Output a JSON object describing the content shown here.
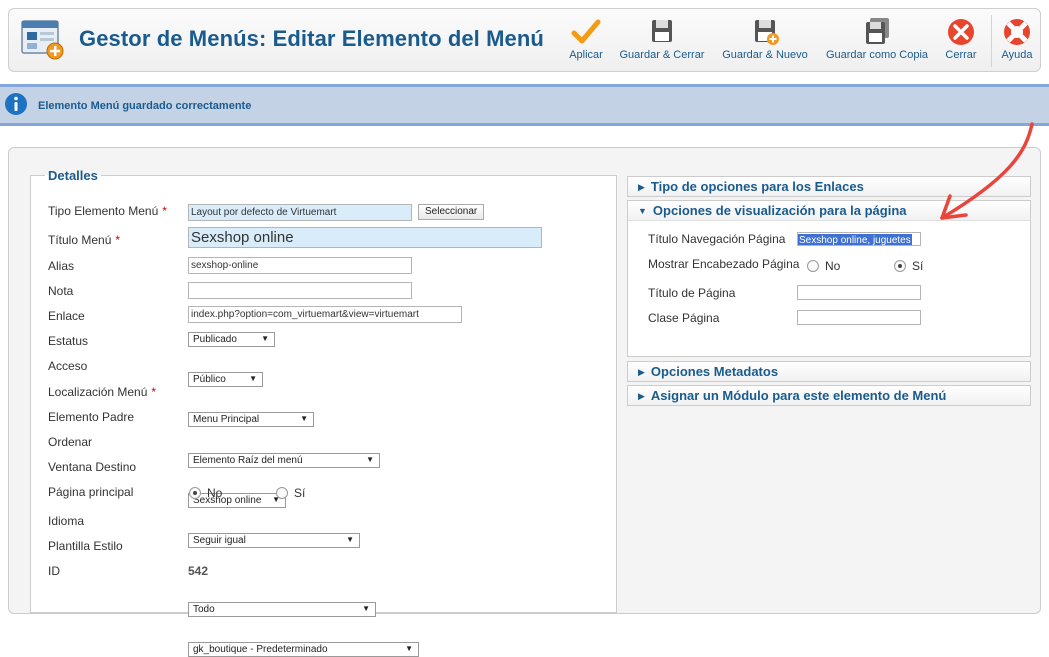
{
  "header": {
    "title": "Gestor de Menús: Editar Elemento del Menú"
  },
  "toolbar": [
    {
      "id": "apply",
      "label": "Aplicar",
      "icon": "checkmark-icon"
    },
    {
      "id": "save-close",
      "label": "Guardar & Cerrar",
      "icon": "floppy-icon"
    },
    {
      "id": "save-new",
      "label": "Guardar & Nuevo",
      "icon": "floppy-plus-icon"
    },
    {
      "id": "save-copy",
      "label": "Guardar como Copia",
      "icon": "floppy-copy-icon"
    },
    {
      "id": "close",
      "label": "Cerrar",
      "icon": "cancel-icon"
    },
    {
      "id": "help",
      "label": "Ayuda",
      "icon": "lifebuoy-icon"
    }
  ],
  "message": {
    "text": "Elemento Menú guardado correctamente",
    "icon": "info-icon"
  },
  "details": {
    "legend": "Detalles",
    "menu_type": {
      "label": "Tipo Elemento Menú",
      "value": "Layout por defecto de Virtuemart",
      "button": "Seleccionar"
    },
    "menu_title": {
      "label": "Título Menú",
      "value": "Sexshop online"
    },
    "alias": {
      "label": "Alias",
      "value": "sexshop-online"
    },
    "note": {
      "label": "Nota",
      "value": ""
    },
    "link": {
      "label": "Enlace",
      "value": "index.php?option=com_virtuemart&view=virtuemart"
    },
    "status": {
      "label": "Estatus",
      "value": "Publicado"
    },
    "access": {
      "label": "Acceso",
      "value": "Público"
    },
    "menu_location": {
      "label": "Localización Menú",
      "value": "Menu Principal"
    },
    "parent": {
      "label": "Elemento Padre",
      "value": "Elemento Raíz del menú"
    },
    "ordering": {
      "label": "Ordenar",
      "value": "Sexshop online"
    },
    "target": {
      "label": "Ventana Destino",
      "value": "Seguir igual"
    },
    "home": {
      "label": "Página principal",
      "options": [
        "No",
        "Sí"
      ],
      "selected": "No"
    },
    "language": {
      "label": "Idioma",
      "value": "Todo"
    },
    "template_style": {
      "label": "Plantilla Estilo",
      "value": "gk_boutique - Predeterminado"
    },
    "id": {
      "label": "ID",
      "value": "542"
    },
    "required_mark": "*"
  },
  "accordion": {
    "link_type": {
      "title": "Tipo de opciones para los Enlaces"
    },
    "page_display": {
      "title": "Opciones de visualización para la página",
      "browser_title": {
        "label": "Título Navegación Página",
        "value": "Sexshop online, juguetes"
      },
      "show_heading": {
        "label": "Mostrar Encabezado Página",
        "options": [
          "No",
          "Sí"
        ],
        "selected": "Sí"
      },
      "page_heading": {
        "label": "Título de Página",
        "value": ""
      },
      "page_class": {
        "label": "Clase Página",
        "value": ""
      }
    },
    "metadata": {
      "title": "Opciones Metadatos"
    },
    "module_assign": {
      "title": "Asignar un Módulo para este elemento de Menú"
    }
  },
  "colors": {
    "brand_blue": "#1a5b8e",
    "message_bg": "#c3d2e5",
    "required_red": "#cc0000",
    "annotation_arrow": "#e8453c"
  }
}
